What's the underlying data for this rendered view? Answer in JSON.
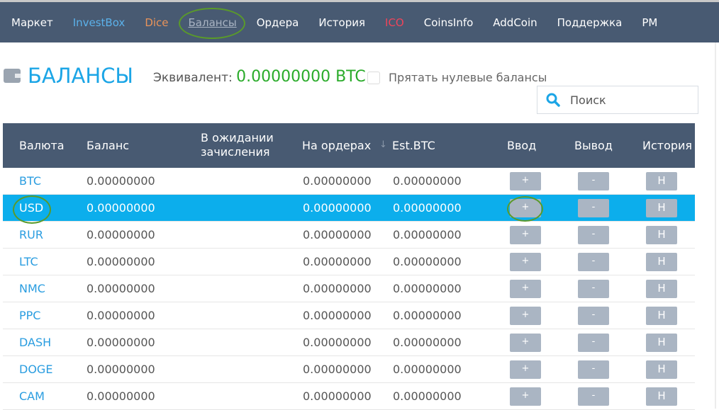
{
  "nav": [
    {
      "label": "Маркет",
      "style": "white"
    },
    {
      "label": "InvestBox",
      "style": "blue"
    },
    {
      "label": "Dice",
      "style": "orange"
    },
    {
      "label": "Балансы",
      "style": "active"
    },
    {
      "label": "Ордера",
      "style": "white"
    },
    {
      "label": "История",
      "style": "white"
    },
    {
      "label": "ICO",
      "style": "red"
    },
    {
      "label": "CoinsInfo",
      "style": "white"
    },
    {
      "label": "AddCoin",
      "style": "white"
    },
    {
      "label": "Поддержка",
      "style": "white"
    },
    {
      "label": "PM",
      "style": "white"
    }
  ],
  "page": {
    "title": "БАЛАНСЫ",
    "equiv_label": "Эквивалент:",
    "equiv_value": "0.00000000 BTC",
    "hide_zero_label": "Прятать нулевые балансы",
    "search_placeholder": "Поиск"
  },
  "table": {
    "headers": {
      "currency": "Валюта",
      "balance": "Баланс",
      "pending": "В ожидании зачисления",
      "orders": "На ордерах",
      "sort_arrow": "↓",
      "est": "Est.BTC",
      "deposit": "Ввод",
      "withdraw": "Вывод",
      "history": "История"
    },
    "buttons": {
      "deposit": "+",
      "withdraw": "-",
      "history": "H"
    },
    "rows": [
      {
        "currency": "BTC",
        "balance": "0.00000000",
        "pending": "",
        "orders": "0.00000000",
        "est": "0.00000000"
      },
      {
        "currency": "USD",
        "balance": "0.00000000",
        "pending": "",
        "orders": "0.00000000",
        "est": "0.00000000",
        "selected": true
      },
      {
        "currency": "RUR",
        "balance": "0.00000000",
        "pending": "",
        "orders": "0.00000000",
        "est": "0.00000000"
      },
      {
        "currency": "LTC",
        "balance": "0.00000000",
        "pending": "",
        "orders": "0.00000000",
        "est": "0.00000000"
      },
      {
        "currency": "NMC",
        "balance": "0.00000000",
        "pending": "",
        "orders": "0.00000000",
        "est": "0.00000000"
      },
      {
        "currency": "PPC",
        "balance": "0.00000000",
        "pending": "",
        "orders": "0.00000000",
        "est": "0.00000000"
      },
      {
        "currency": "DASH",
        "balance": "0.00000000",
        "pending": "",
        "orders": "0.00000000",
        "est": "0.00000000"
      },
      {
        "currency": "DOGE",
        "balance": "0.00000000",
        "pending": "",
        "orders": "0.00000000",
        "est": "0.00000000"
      },
      {
        "currency": "CAM",
        "balance": "0.00000000",
        "pending": "",
        "orders": "0.00000000",
        "est": "0.00000000"
      }
    ]
  }
}
